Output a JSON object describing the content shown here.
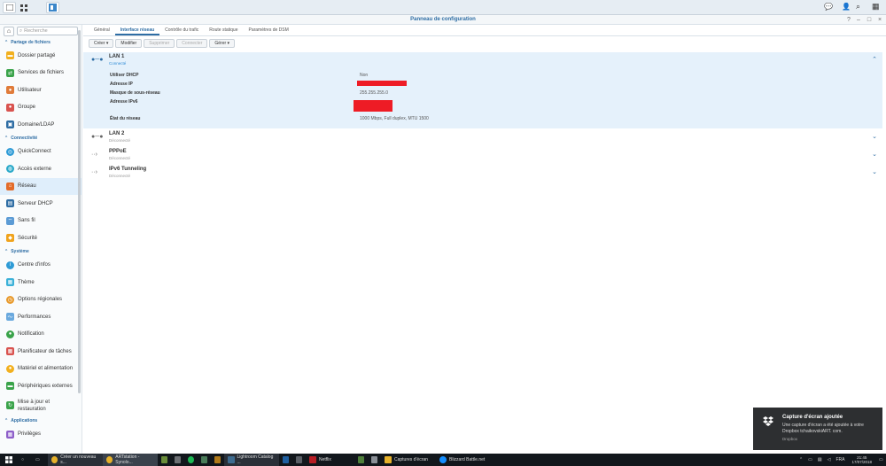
{
  "window": {
    "title": "Panneau de configuration"
  },
  "sidebar": {
    "search_placeholder": "Recherche",
    "sections": [
      {
        "title": "Partage de fichiers",
        "items": [
          "Dossier partagé",
          "Services de fichiers",
          "Utilisateur",
          "Groupe",
          "Domaine/LDAP"
        ]
      },
      {
        "title": "Connectivité",
        "items": [
          "QuickConnect",
          "Accès externe",
          "Réseau",
          "Serveur DHCP",
          "Sans fil",
          "Sécurité"
        ]
      },
      {
        "title": "Système",
        "items": [
          "Centre d'infos",
          "Thème",
          "Options régionales",
          "Performances",
          "Notification",
          "Planificateur de tâches",
          "Matériel et alimentation",
          "Périphériques externes",
          "Mise à jour et restauration"
        ]
      },
      {
        "title": "Applications",
        "items": [
          "Privilèges"
        ]
      }
    ]
  },
  "tabs": [
    "Général",
    "Interface réseau",
    "Contrôle du trafic",
    "Route statique",
    "Paramètres de DSM"
  ],
  "toolbar": {
    "create": "Créer",
    "modify": "Modifier",
    "delete": "Supprimer",
    "connect": "Connecter",
    "manage": "Gérer"
  },
  "interfaces": [
    {
      "name": "LAN 1",
      "status": "Connecté"
    },
    {
      "name": "LAN 2",
      "status": "Déconnecté"
    },
    {
      "name": "PPPoE",
      "status": "Déconnecté"
    },
    {
      "name": "IPv6 Tunneling",
      "status": "Déconnecté"
    }
  ],
  "lan1_details": {
    "dhcp_label": "Utiliser DHCP",
    "dhcp_value": "Non",
    "ip_label": "Adresse IP",
    "mask_label": "Masque de sous-réseau",
    "mask_value": "255.255.255.0",
    "ipv6_label": "Adresse IPv6",
    "state_label": "État du réseau",
    "state_value": "1000 Mbps, Full duplex, MTU 1500"
  },
  "taskbar": {
    "items": [
      "Créer un nouveau s...",
      "ARTstation - Synolo...",
      "Lightroom Catalog ...",
      "Netflix",
      "Captures d'écran",
      "Blizzard Battle.net"
    ],
    "language": "FRA",
    "time": "21:45",
    "date": "17/07/2018"
  },
  "notification": {
    "title": "Capture d'écran ajoutée",
    "body": "Une capture d'écran a été ajoutée à votre Dropbox tchaikovskiART. com.",
    "source": "Dropbox"
  },
  "colors": {
    "accent": "#2e6da4",
    "selected_row": "#e5f1fb",
    "redaction": "#ee1c25"
  }
}
